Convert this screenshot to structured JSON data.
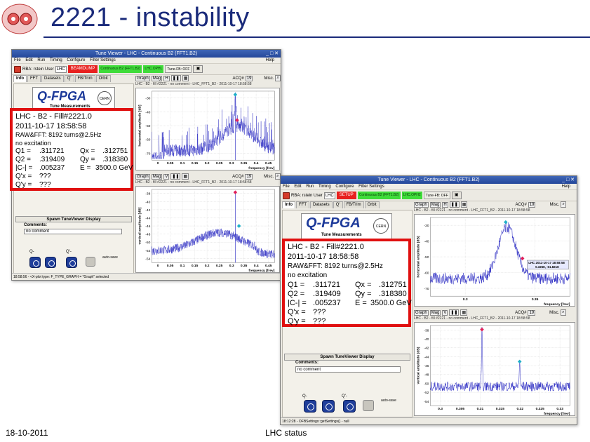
{
  "slide": {
    "title": "2221 - instability",
    "date": "18-10-2011",
    "footer": "LHC status"
  },
  "win1": {
    "title": "Tune Viewer - LHC - Continuous B2 (FFT1.B2)",
    "menu": [
      "File",
      "Edit",
      "Run",
      "Timing",
      "Configure",
      "Filter Settings"
    ],
    "help": "Help",
    "rbac": "RBA: rstein User",
    "machine": "LHC",
    "status_red": "BEAMDUMP",
    "status_green1": "Continuous B2 (FFT1.B2)",
    "status_green2": "LHC.OPHL",
    "tune_fb": "Tune-FB: OFF",
    "tabs": [
      "Info",
      "FFT",
      "Datasets",
      "Q'",
      "FB/Trim",
      "Orbit"
    ],
    "statusbar": "18:58:56 - <X-plot type: F_TYPE_GRAPH = \"Graph\" selected"
  },
  "win2": {
    "title": "Tune Viewer - LHC - Continuous B2 (FFT1.B2)",
    "menu": [
      "File",
      "Edit",
      "Run",
      "Timing",
      "Configure",
      "Filter Settings"
    ],
    "help": "Help",
    "rbac": "RBA: rstein User",
    "machine": "LHC",
    "status_red": "SETUP",
    "status_green1": "Continuous B2 (FFT1.B2)",
    "status_green2": "LHC.OPH2",
    "tune_fb": "Tune-FB: OFF",
    "tabs": [
      "Info",
      "FFT",
      "Datasets",
      "Q'",
      "FB/Trim",
      "Orbit"
    ],
    "statusbar": "18:12:28 - OFBSettings::getSettings() - null"
  },
  "qfpga": {
    "logo": "Q-FPGA",
    "subtitle": "Tune Measurements",
    "cern": "CERN"
  },
  "info": {
    "l1": "LHC - B2 - Fill#2221.0",
    "l2": "2011-10-17 18:58:58",
    "l3": "RAW&FFT: 8192 turns@2.5Hz",
    "l4": "no excitation",
    "q1_lbl": "Q1 =",
    "q1": ".311721",
    "qx_lbl": "Qx =",
    "qx": ".312751",
    "q2_lbl": "Q2 =",
    "q2": ".319409",
    "qy_lbl": "Qy =",
    "qy": ".318380",
    "c_lbl": "|C-| =",
    "c": ".005237",
    "e_lbl": "E =",
    "e": "3500.0 GeV",
    "qpx_lbl": "Q'x =",
    "qpx": "???",
    "qpy_lbl": "Q'y =",
    "qpy": "???"
  },
  "panel": {
    "spawn": "Spawn TuneViewer Display",
    "comments_label": "Comments:",
    "comments_value": "no comment",
    "q_label": "Q-",
    "qp_label": "Q'-",
    "autosave": "auto-save"
  },
  "plots": {
    "graph": "Graph",
    "mag": "Mag",
    "acq_label": "ACQ#",
    "acq_value": "19",
    "misc": "Misc.",
    "subtitle": "LHC - B2 - fill #2221 - no comment - LHC_FFT1_B2 - 2011-10-17 18:58:58",
    "h_ylabel": "horizontal amplitude [dB]",
    "v_ylabel": "vertical amplitude [dB]",
    "xlabel": "frequency [frev]",
    "marker_label1": "LHC 2011-10-17 18:58:58",
    "marker_label2": "0.3258, -61.8218",
    "w1_h_yticks": [
      "-30",
      "-40",
      "-50",
      "-60",
      "-70"
    ],
    "w1_h_xticks": [
      "0",
      "0.05",
      "0.1",
      "0.15",
      "0.2",
      "0.25",
      "0.3",
      "0.35",
      "0.4",
      "0.45"
    ],
    "w1_v_yticks": [
      "-38",
      "-40",
      "-42",
      "-44",
      "-46",
      "-48",
      "-50",
      "-52",
      "-54"
    ],
    "w1_v_xticks": [
      "0",
      "0.05",
      "0.1",
      "0.15",
      "0.2",
      "0.25",
      "0.3",
      "0.35",
      "0.4",
      "0.45"
    ],
    "w2_h_yticks": [
      "-30",
      "-40",
      "-50",
      "-60",
      "-70"
    ],
    "w2_h_xticks": [
      "0.3",
      "0.35"
    ],
    "w2_v_yticks": [
      "-38",
      "-40",
      "-42",
      "-44",
      "-46",
      "-48",
      "-50",
      "-52",
      "-54"
    ],
    "w2_v_xticks": [
      "0.3",
      "0.305",
      "0.31",
      "0.315",
      "0.32",
      "0.325",
      "0.33"
    ]
  },
  "colors": {
    "trace": "#1f1fbf",
    "marker_q": "#1fb0c8",
    "marker_red": "#e0205a",
    "red_border": "#e01010"
  }
}
